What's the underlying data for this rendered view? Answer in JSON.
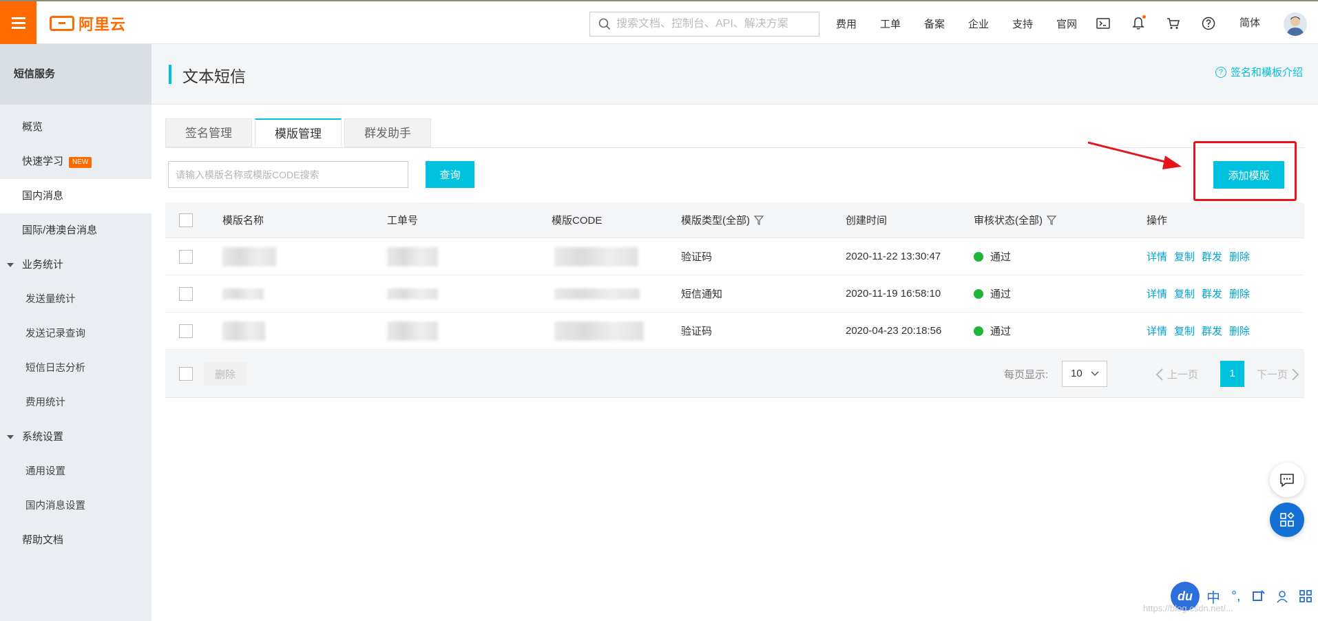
{
  "topbar": {
    "logo_text": "阿里云",
    "search_placeholder": "搜索文档、控制台、API、解决方案",
    "nav": [
      "费用",
      "工单",
      "备案",
      "企业",
      "支持",
      "官网"
    ],
    "icons": [
      "terminal-icon",
      "bell-icon",
      "cart-icon",
      "help-icon"
    ],
    "lang": "简体"
  },
  "sidebar": {
    "header": "短信服务",
    "items": [
      {
        "label": "概览"
      },
      {
        "label": "快速学习",
        "badge": "NEW"
      },
      {
        "label": "国内消息"
      },
      {
        "label": "国际/港澳台消息"
      },
      {
        "label": "业务统计"
      },
      {
        "label": "发送量统计"
      },
      {
        "label": "发送记录查询"
      },
      {
        "label": "短信日志分析"
      },
      {
        "label": "费用统计"
      },
      {
        "label": "系统设置"
      },
      {
        "label": "通用设置"
      },
      {
        "label": "国内消息设置"
      },
      {
        "label": "帮助文档"
      }
    ]
  },
  "page": {
    "title": "文本短信",
    "help_link": "签名和模板介绍",
    "tabs": [
      "签名管理",
      "模版管理",
      "群发助手"
    ],
    "active_tab": "模版管理",
    "filter_placeholder": "请输入模版名称或模版CODE搜索",
    "query_label": "查询",
    "add_label": "添加模版"
  },
  "table": {
    "headers": [
      "模版名称",
      "工单号",
      "模版CODE",
      "模版类型(全部)",
      "创建时间",
      "审核状态(全部)",
      "操作"
    ],
    "rows": [
      {
        "type": "验证码",
        "created": "2020-11-22 13:30:47",
        "status": "通过"
      },
      {
        "type": "短信通知",
        "created": "2020-11-19 16:58:10",
        "status": "通过"
      },
      {
        "type": "验证码",
        "created": "2020-04-23 20:18:56",
        "status": "通过"
      }
    ],
    "row_actions": [
      "详情",
      "复制",
      "群发",
      "删除"
    ],
    "status_color": "#1fb53d"
  },
  "footer": {
    "delete_label": "删除",
    "per_page_label": "每页显示:",
    "per_page_value": "10",
    "prev_label": "上一页",
    "current_page": "1",
    "next_label": "下一页"
  },
  "ime": {
    "logo": "du",
    "items": [
      "中",
      "°,"
    ]
  },
  "watermark": "https://blog.csdn.net/..."
}
